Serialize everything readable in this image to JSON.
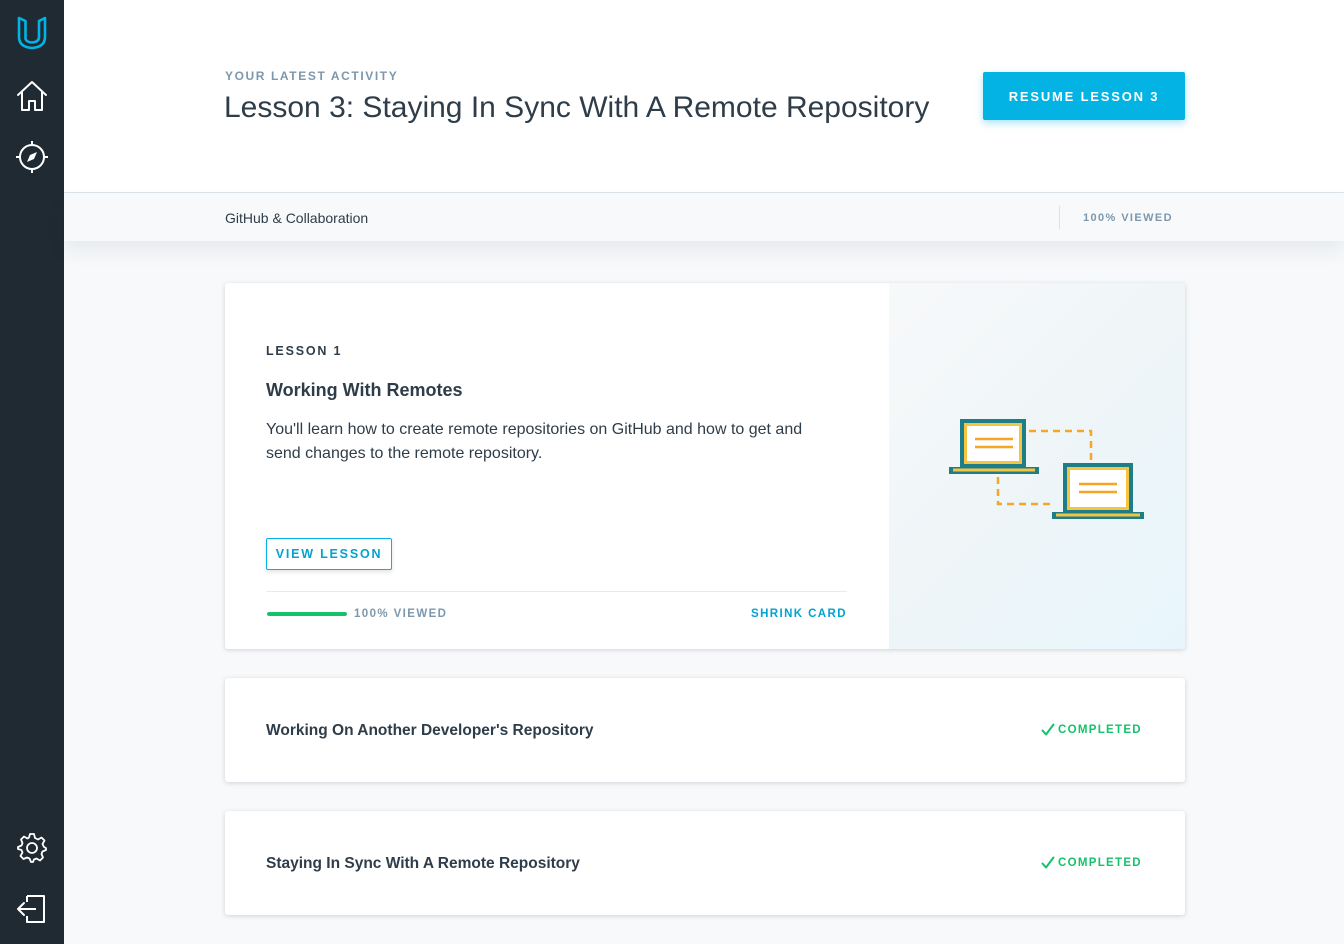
{
  "header": {
    "eyebrow": "YOUR LATEST ACTIVITY",
    "title": "Lesson 3: Staying In Sync With A Remote Repository",
    "resume_button": "RESUME LESSON 3"
  },
  "subheader": {
    "course_name": "GitHub & Collaboration",
    "progress_label": "100% VIEWED"
  },
  "sidebar": {
    "icons": [
      "udacity-logo-icon",
      "home-icon",
      "compass-icon",
      "settings-gear-icon",
      "logout-icon"
    ]
  },
  "lesson_card": {
    "number_label": "LESSON 1",
    "title": "Working With Remotes",
    "description": "You'll learn how to create remote repositories on GitHub and how to get and send changes to the remote repository.",
    "view_button": "VIEW LESSON",
    "progress": 1.0,
    "progress_label": "100% VIEWED",
    "shrink_link": "SHRINK CARD",
    "illustration": "two-laptops-connected-icon"
  },
  "lessons": [
    {
      "title": "Working On Another Developer's Repository",
      "status": "COMPLETED"
    },
    {
      "title": "Staying In Sync With A Remote Repository",
      "status": "COMPLETED"
    }
  ],
  "colors": {
    "sidebar_bg": "#1f2a33",
    "accent": "#02b3e4",
    "success": "#15c26b",
    "muted": "#7d97ad",
    "text": "#2e3d49",
    "illustration_teal": "#1f7d88",
    "illustration_amber": "#f5a623"
  }
}
